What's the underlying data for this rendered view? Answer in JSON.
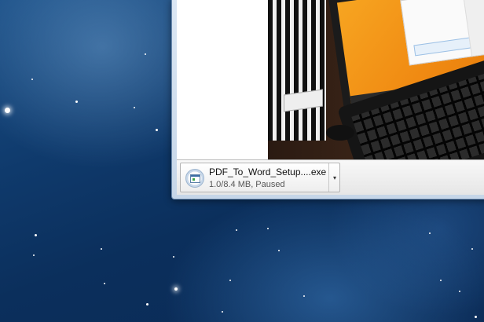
{
  "download_shelf": {
    "item": {
      "icon": "installer-icon",
      "filename": "PDF_To_Word_Setup....exe",
      "status": "1.0/8.4 MB, Paused",
      "menu_icon": "chevron-down-icon",
      "menu_glyph": "▾"
    }
  },
  "colors": {
    "desktop_bg": "#0f3a6c",
    "window_frame": "#c6d6e8",
    "shelf_bg": "#eeeeee"
  }
}
